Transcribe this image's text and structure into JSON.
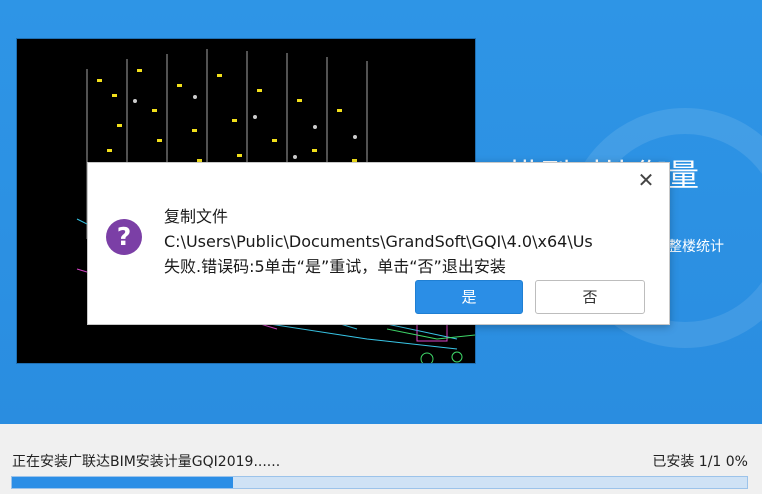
{
  "hero": {
    "title": "模型对比衡量",
    "subtitle": "整楼统计"
  },
  "dialog": {
    "close_glyph": "✕",
    "icon": "question-icon",
    "icon_glyph": "?",
    "line1": "复制文件",
    "line2": "C:\\Users\\Public\\Documents\\GrandSoft\\GQI\\4.0\\x64\\Us",
    "line3": "失败.错误码:5单击“是”重试，单击“否”退出安装",
    "yes_label": "是",
    "no_label": "否"
  },
  "footer": {
    "status": "正在安装广联达BIM安装计量GQI2019......",
    "count": "已安装 1/1 0%",
    "progress_fraction": 0.3
  },
  "colors": {
    "accent": "#2b8ee6",
    "background": "#2e95e6",
    "icon_purple": "#7b3fa6"
  }
}
